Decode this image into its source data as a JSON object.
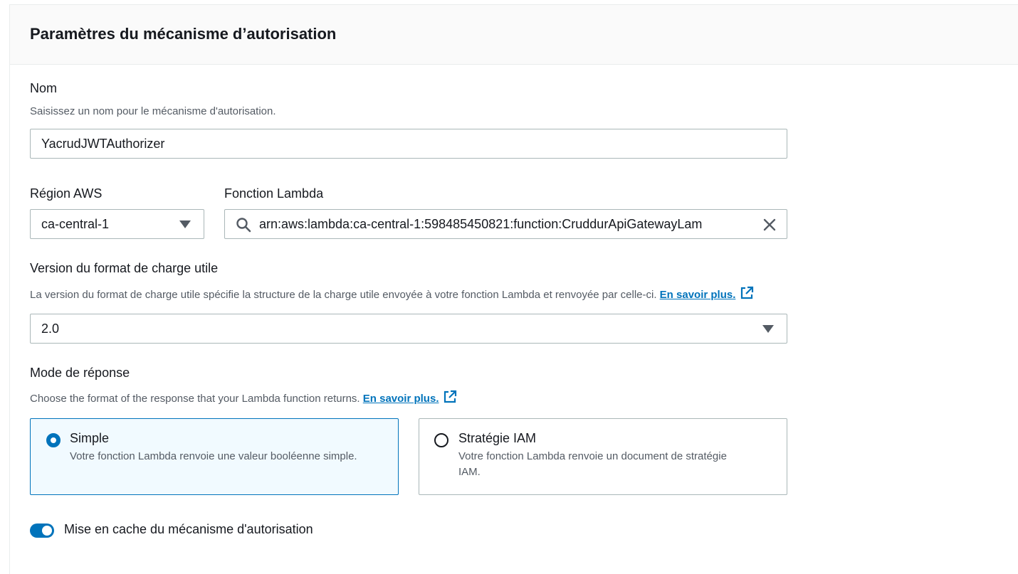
{
  "section": {
    "title": "Paramètres du mécanisme d’autorisation"
  },
  "name_field": {
    "label": "Nom",
    "description": "Saisissez un nom pour le mécanisme d'autorisation.",
    "value": "YacrudJWTAuthorizer"
  },
  "region_field": {
    "label": "Région AWS",
    "value": "ca-central-1"
  },
  "lambda_field": {
    "label": "Fonction Lambda",
    "value": "arn:aws:lambda:ca-central-1:598485450821:function:CruddurApiGatewayLam"
  },
  "payload_field": {
    "label": "Version du format de charge utile",
    "description": "La version du format de charge utile spécifie la structure de la charge utile envoyée à votre fonction Lambda et renvoyée par celle-ci.",
    "learn_more": "En savoir plus.",
    "value": "2.0"
  },
  "response_mode": {
    "label": "Mode de réponse",
    "description": "Choose the format of the response that your Lambda function returns.",
    "learn_more": "En savoir plus.",
    "options": [
      {
        "title": "Simple",
        "description": "Votre fonction Lambda renvoie une valeur booléenne simple.",
        "selected": true
      },
      {
        "title": "Stratégie IAM",
        "description": "Votre fonction Lambda renvoie un document de stratégie IAM.",
        "selected": false
      }
    ]
  },
  "caching": {
    "label": "Mise en cache du mécanisme d'autorisation",
    "enabled": true
  },
  "colors": {
    "accent": "#0073bb",
    "border": "#aab7b8",
    "muted_text": "#545b64"
  }
}
